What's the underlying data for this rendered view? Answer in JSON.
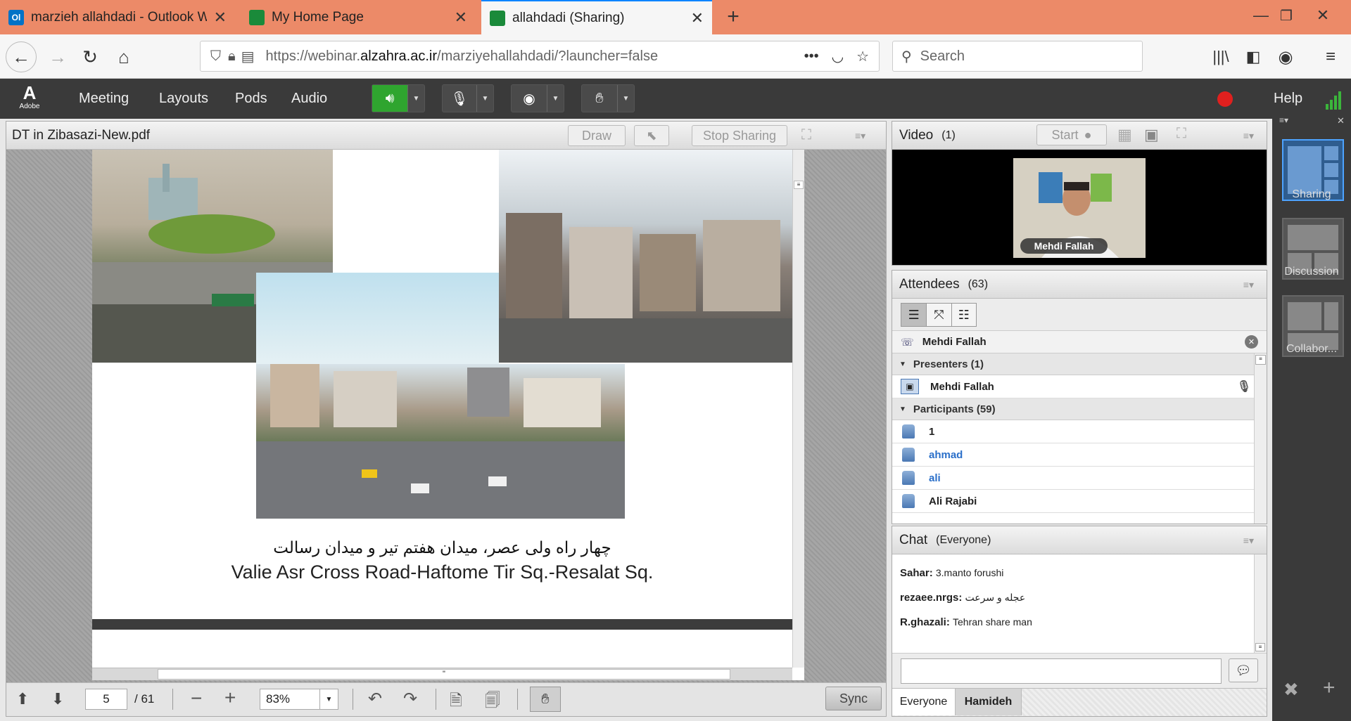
{
  "browser": {
    "tabs": [
      {
        "title": "marzieh allahdadi - Outlook W",
        "icon_color": "#0072c6"
      },
      {
        "title": "My Home Page",
        "icon_color": "#1a8a3a"
      },
      {
        "title": "allahdadi (Sharing)",
        "icon_color": "#1a8a3a"
      }
    ],
    "url_prefix": "https://webinar.",
    "url_domain": "alzahra.ac.ir",
    "url_path": "/marziyehallahdadi/?launcher=false",
    "search_placeholder": "Search"
  },
  "connect": {
    "logo": "Adobe",
    "menu": [
      "Meeting",
      "Layouts",
      "Pods",
      "Audio"
    ],
    "help": "Help"
  },
  "share_pod": {
    "title": "DT in Zibasazi-New.pdf",
    "draw_label": "Draw",
    "stop_sharing_label": "Stop Sharing",
    "slide_caption_fa": "چهار راه ولی عصر، میدان هفتم تیر و میدان رسالت",
    "slide_caption_en": "Valie Asr Cross Road-Haftome Tir Sq.-Resalat Sq.",
    "page_current": "5",
    "page_total": "/ 61",
    "zoom": "83%",
    "sync_label": "Sync",
    "hscroll_grip": "\""
  },
  "video_pod": {
    "title": "Video",
    "count": "(1)",
    "start_label": "Start",
    "name_tag": "Mehdi Fallah"
  },
  "attendees_pod": {
    "title": "Attendees",
    "count": "(63)",
    "selected_user": "Mehdi Fallah",
    "presenters_label": "Presenters (1)",
    "presenters": [
      "Mehdi Fallah"
    ],
    "participants_label": "Participants (59)",
    "participants": [
      {
        "name": "1",
        "highlight": false
      },
      {
        "name": "ahmad",
        "highlight": true
      },
      {
        "name": "ali",
        "highlight": true
      },
      {
        "name": "Ali Rajabi",
        "highlight": false
      }
    ]
  },
  "chat_pod": {
    "title": "Chat",
    "scope": "(Everyone)",
    "messages": [
      {
        "sender": "Sahar:",
        "text": "3.manto forushi"
      },
      {
        "sender": "rezaee.nrgs:",
        "text": "عجله و سرعت"
      },
      {
        "sender": "R.ghazali:",
        "text": "Tehran share man"
      }
    ],
    "tabs": [
      "Everyone",
      "Hamideh"
    ]
  },
  "layouts": [
    {
      "label": "Sharing",
      "active": true
    },
    {
      "label": "Discussion",
      "active": false
    },
    {
      "label": "Collabor...",
      "active": false
    }
  ],
  "colors": {
    "tabbar": "#ec8a68",
    "accent_blue": "#0a84ff",
    "record": "#e0201e",
    "speaker_green": "#2fa52f"
  }
}
